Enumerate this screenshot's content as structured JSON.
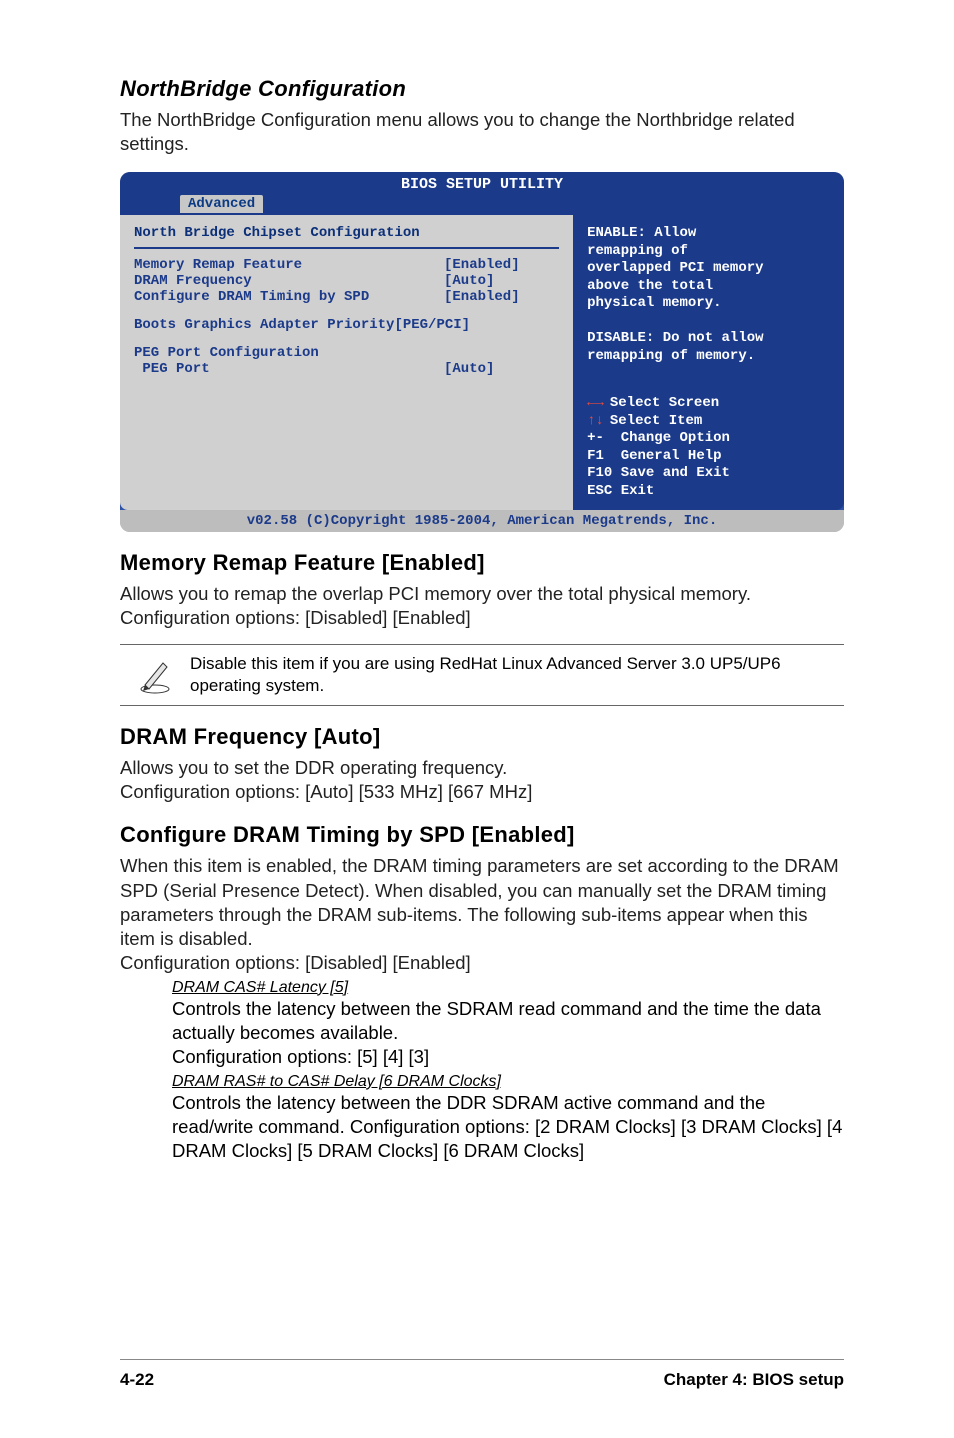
{
  "sec1_title": "NorthBridge Configuration",
  "sec1_body": "The NorthBridge Configuration menu allows you to change the Northbridge related settings.",
  "bios": {
    "title": "BIOS SETUP UTILITY",
    "tab": "Advanced",
    "left": {
      "header": "North Bridge Chipset Configuration",
      "rows": [
        {
          "lbl": "Memory Remap Feature",
          "val": "[Enabled]"
        },
        {
          "lbl": "DRAM Frequency",
          "val": "[Auto]"
        },
        {
          "lbl": "Configure DRAM Timing by SPD",
          "val": "[Enabled]"
        }
      ],
      "boots": "Boots Graphics Adapter Priority[PEG/PCI]",
      "peg_hdr": "PEG Port Configuration",
      "peg_row": {
        "lbl": " PEG Port",
        "val": "[Auto]"
      }
    },
    "right": {
      "help": [
        "ENABLE: Allow",
        "remapping of",
        "overlapped PCI memory",
        "above the total",
        "physical memory.",
        "",
        "DISABLE: Do not allow",
        "remapping of memory."
      ],
      "keys": [
        {
          "g": "lr",
          "t": "Select Screen"
        },
        {
          "g": "ud",
          "t": "Select Item"
        },
        {
          "g": "pm",
          "t": "Change Option"
        },
        {
          "g": "f1",
          "t": "General Help"
        },
        {
          "g": "f10",
          "t": "Save and Exit"
        },
        {
          "g": "esc",
          "t": "Exit"
        }
      ]
    },
    "footer": "v02.58 (C)Copyright 1985-2004, American Megatrends, Inc."
  },
  "mem_title": "Memory Remap Feature [Enabled]",
  "mem_body": "Allows you to remap the overlap PCI memory over the total physical memory. Configuration options: [Disabled] [Enabled]",
  "note_text": "Disable this item if you are using RedHat Linux Advanced Server 3.0 UP5/UP6 operating system.",
  "dram_title": "DRAM Frequency [Auto]",
  "dram_body1": "Allows you to set the DDR operating frequency.",
  "dram_body2": "Configuration options: [Auto] [533 MHz] [667 MHz]",
  "spd_title": "Configure DRAM Timing by SPD [Enabled]",
  "spd_body": "When this item is enabled, the DRAM timing parameters are set according to the DRAM SPD (Serial Presence Detect). When disabled, you can manually set the DRAM timing parameters through the DRAM sub-items. The following sub-items appear when this item is disabled.",
  "spd_body2": "Configuration options: [Disabled] [Enabled]",
  "cas_u": "DRAM CAS# Latency [5]",
  "cas_body": "Controls the latency between the SDRAM read command and the time the data actually becomes available.",
  "cas_cfg": "Configuration options: [5] [4] [3]",
  "ras_u": "DRAM RAS# to CAS# Delay [6 DRAM Clocks]",
  "ras_body": "Controls the latency between the DDR SDRAM active command and the read/write command. Configuration options: [2 DRAM Clocks] [3 DRAM Clocks] [4 DRAM Clocks] [5 DRAM Clocks] [6 DRAM Clocks]",
  "footer_left": "4-22",
  "footer_right": "Chapter 4: BIOS setup"
}
